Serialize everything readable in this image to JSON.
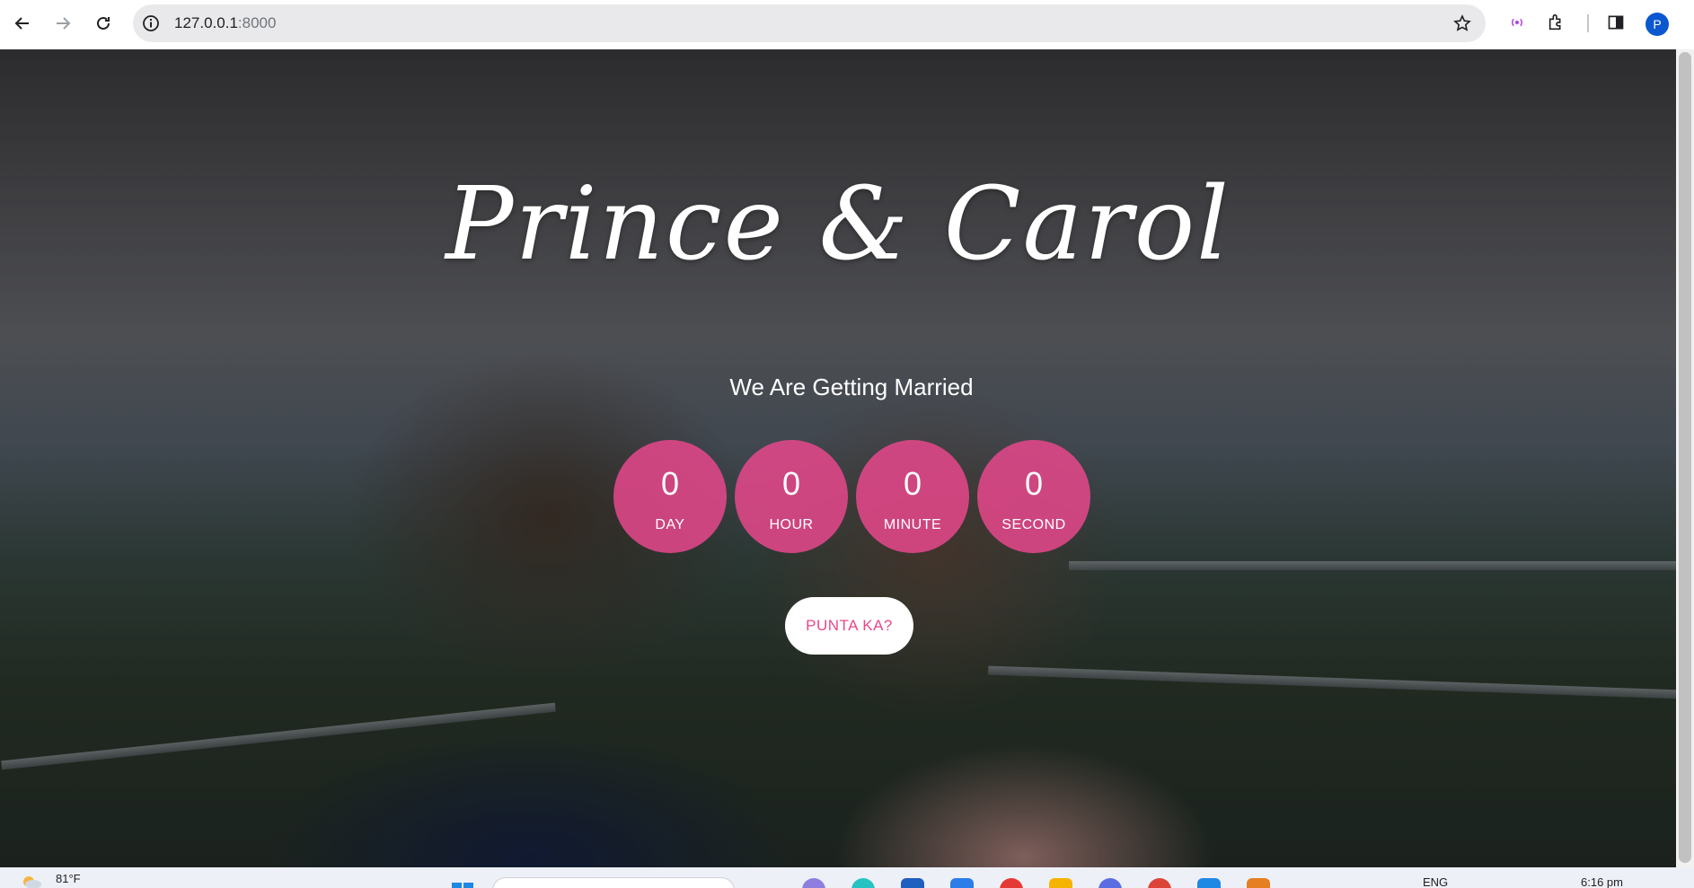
{
  "browser": {
    "url_host": "127.0.0.1",
    "url_port": ":8000",
    "profile_initial": "P"
  },
  "hero": {
    "title": "Prince & Carol",
    "subtitle": "We Are Getting Married",
    "countdown": [
      {
        "value": "0",
        "label": "DAY"
      },
      {
        "value": "0",
        "label": "HOUR"
      },
      {
        "value": "0",
        "label": "MINUTE"
      },
      {
        "value": "0",
        "label": "SECOND"
      }
    ],
    "cta_label": "PUNTA KA?",
    "accent_color": "#e8488c"
  },
  "taskbar": {
    "weather": "81°F",
    "language": "ENG",
    "time": "6:16 pm"
  }
}
